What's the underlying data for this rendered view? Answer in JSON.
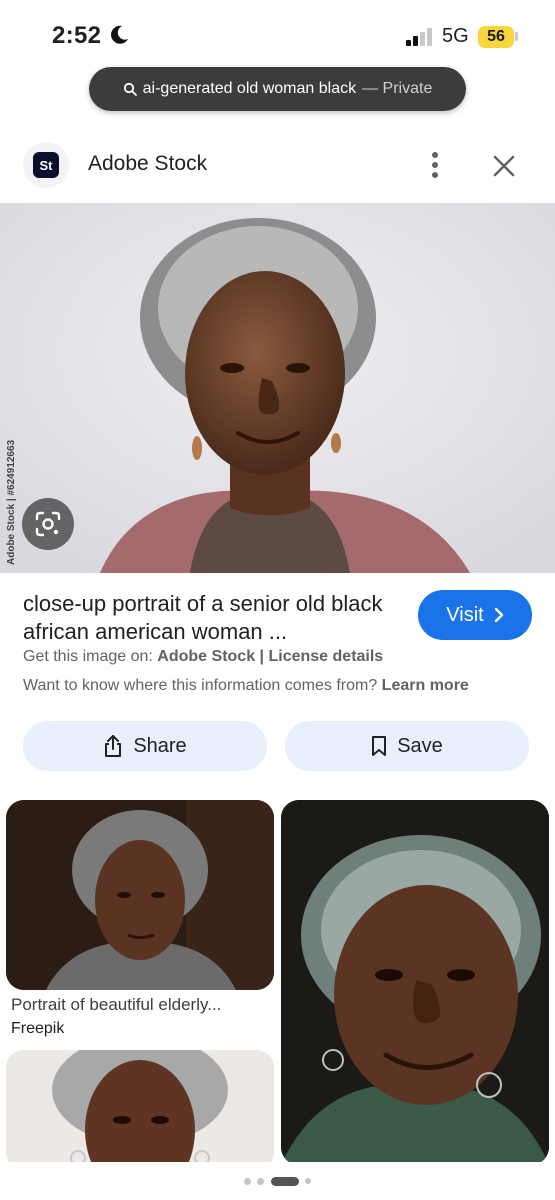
{
  "status_bar": {
    "time": "2:52",
    "network": "5G",
    "battery": "56"
  },
  "search": {
    "query": "ai-generated old woman black",
    "mode": "— Private"
  },
  "source": {
    "logo_text": "St",
    "name": "Adobe Stock"
  },
  "main_image": {
    "watermark": "Adobe Stock | #624912663"
  },
  "result": {
    "title": "close-up portrait of a senior old black african american woman ...",
    "visit_label": "Visit",
    "get_image_prefix": "Get this image on:",
    "get_image_source": "Adobe Stock",
    "separator": "|",
    "license_label": "License details",
    "info_prefix": "Want to know where this information comes from?",
    "learn_more": "Learn more"
  },
  "actions": {
    "share_label": "Share",
    "save_label": "Save"
  },
  "related": [
    {
      "caption": "Portrait of beautiful elderly...",
      "source": "Freepik"
    }
  ],
  "colors": {
    "accent": "#1a73e8",
    "pill_bg": "#3c3c3c",
    "action_bg": "#e8f0fe",
    "battery": "#f7d53c"
  },
  "icons": [
    "moon-icon",
    "signal-icon",
    "search-icon",
    "more-vert-icon",
    "close-icon",
    "lens-icon",
    "chevron-right-icon",
    "share-icon",
    "bookmark-icon"
  ]
}
